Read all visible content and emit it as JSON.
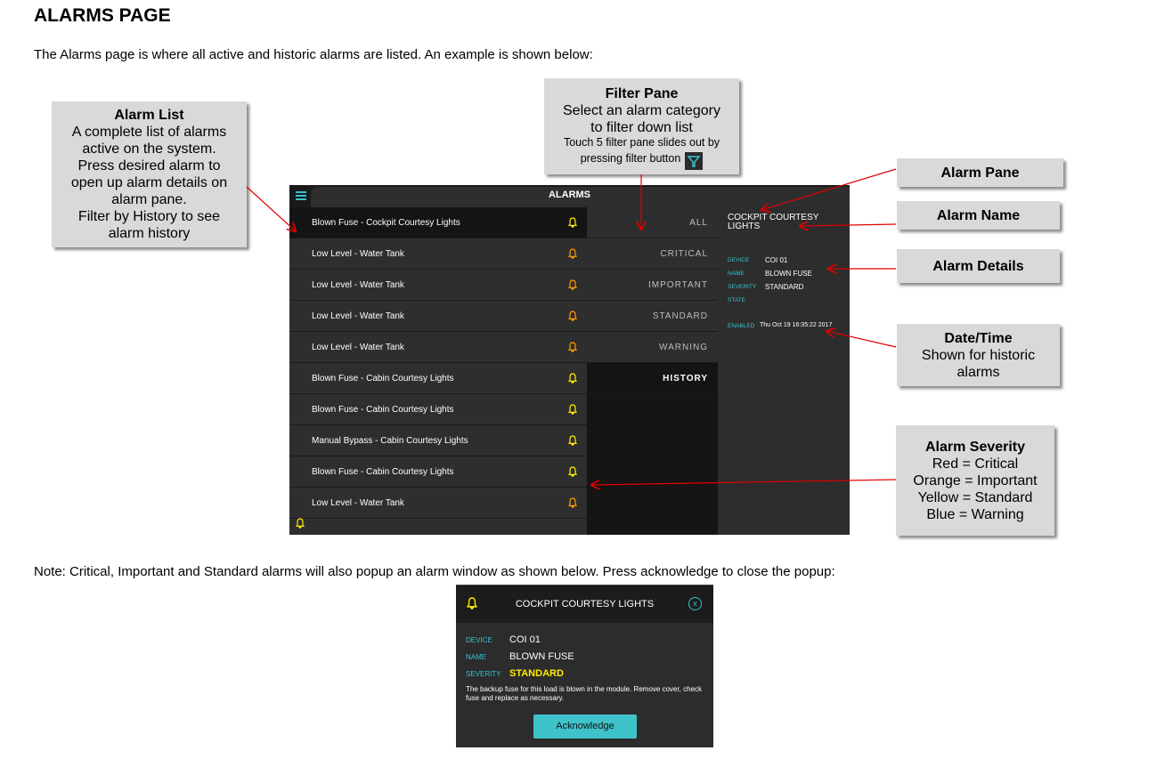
{
  "heading": "ALARMS PAGE",
  "intro": "The Alarms page is where all active and historic alarms are listed.  An example is shown below:",
  "note": "Note: Critical, Important and Standard alarms will also popup an alarm window as shown below.  Press acknowledge to close the popup:",
  "callouts": {
    "alarm_list": {
      "title": "Alarm List",
      "lines": [
        "A complete list of alarms",
        "active on the system.",
        "Press desired alarm to",
        "open up alarm details on",
        "alarm pane.",
        "Filter by History to see",
        "alarm history"
      ]
    },
    "filter_pane": {
      "title": "Filter Pane",
      "line1": "Select an alarm category",
      "line2": "to filter down list",
      "small1": "Touch 5 filter pane slides out by",
      "small2": "pressing filter button"
    },
    "alarm_pane": {
      "title": "Alarm Pane"
    },
    "alarm_name": {
      "title": "Alarm Name"
    },
    "alarm_details": {
      "title": "Alarm Details"
    },
    "date_time": {
      "title": "Date/Time",
      "line1": "Shown for historic",
      "line2": "alarms"
    },
    "alarm_severity": {
      "title": "Alarm Severity",
      "lines": [
        "Red = Critical",
        "Orange = Important",
        "Yellow = Standard",
        "Blue = Warning"
      ]
    }
  },
  "screen": {
    "title": "ALARMS",
    "alarms": [
      {
        "label": "Blown Fuse - Cockpit Courtesy Lights",
        "severity": "standard"
      },
      {
        "label": "Low Level - Water Tank",
        "severity": "important"
      },
      {
        "label": "Low Level - Water Tank",
        "severity": "important"
      },
      {
        "label": "Low Level - Water Tank",
        "severity": "important"
      },
      {
        "label": "Low Level - Water Tank",
        "severity": "important"
      },
      {
        "label": "Blown Fuse - Cabin Courtesy Lights",
        "severity": "standard"
      },
      {
        "label": "Blown Fuse - Cabin Courtesy Lights",
        "severity": "standard"
      },
      {
        "label": "Manual Bypass - Cabin Courtesy Lights",
        "severity": "standard"
      },
      {
        "label": "Blown Fuse - Cabin Courtesy Lights",
        "severity": "standard"
      },
      {
        "label": "Low Level - Water Tank",
        "severity": "important"
      }
    ],
    "filters": [
      "ALL",
      "CRITICAL",
      "IMPORTANT",
      "STANDARD",
      "WARNING",
      "HISTORY"
    ],
    "detail": {
      "name": "COCKPIT COURTESY LIGHTS",
      "device_key": "DEVICE",
      "device": "COI 01",
      "name_key": "NAME",
      "name_value": "BLOWN FUSE",
      "severity_key": "SEVERITY",
      "severity": "STANDARD",
      "state_key": "STATE",
      "enabled_key": "ENABLED",
      "enabled": "Thu Oct 19 16:35:22 2017"
    }
  },
  "popup": {
    "title": "COCKPIT COURTESY LIGHTS",
    "close_glyph": "x",
    "device_key": "DEVICE",
    "device": "COI 01",
    "name_key": "NAME",
    "name_value": "BLOWN FUSE",
    "severity_key": "SEVERITY",
    "severity": "STANDARD",
    "description": "The backup fuse for this load is blown in the module. Remove cover, check fuse and replace as necessary.",
    "button": "Acknowledge"
  },
  "colors": {
    "accent": "#35c3cf",
    "important": "#ff9900",
    "standard": "#ffeb00",
    "arrow": "#e00000"
  },
  "icons": [
    "menu-icon",
    "bell-icon",
    "filter-icon",
    "close-icon"
  ]
}
